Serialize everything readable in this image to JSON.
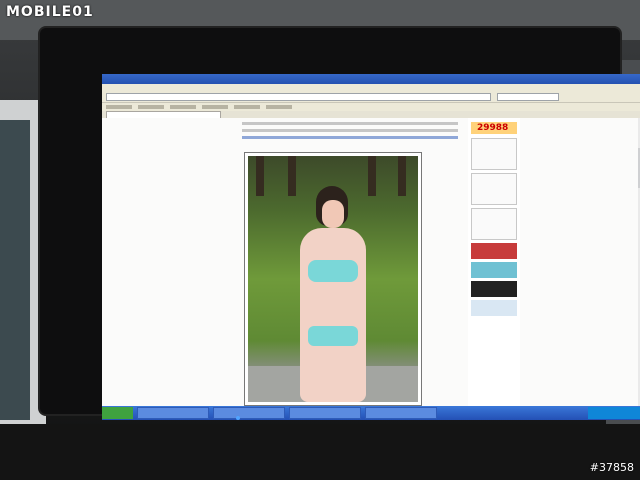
{
  "watermark": "MOBILE01",
  "photo_id": "#37858",
  "browser": {
    "tab_label": "",
    "promo_number": "29988"
  }
}
